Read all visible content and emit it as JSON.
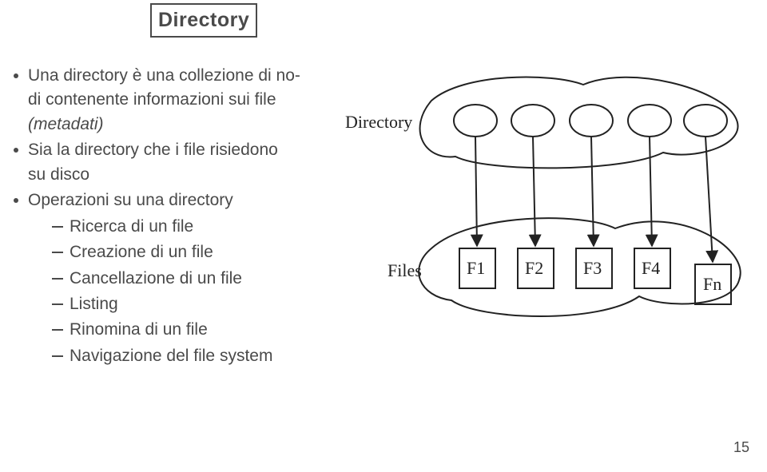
{
  "title": "Directory",
  "bullets": [
    {
      "paras": [
        "Una directory è una collezione di no-",
        "di contenente informazioni sui file",
        "(metadati)"
      ],
      "italic_last": true
    },
    {
      "paras": [
        "Sia la directory che i file risiedono",
        "su disco"
      ]
    },
    {
      "paras": [
        "Operazioni su una directory"
      ],
      "sub": [
        "Ricerca di un file",
        "Creazione di un file",
        "Cancellazione di un file",
        "Listing",
        "Rinomina di un file",
        "Navigazione del file system"
      ]
    }
  ],
  "diagram": {
    "directory_label": "Directory",
    "files_label": "Files",
    "file_boxes": [
      "F1",
      "F2",
      "F3",
      "F4",
      "Fn"
    ]
  },
  "page_number": "15"
}
